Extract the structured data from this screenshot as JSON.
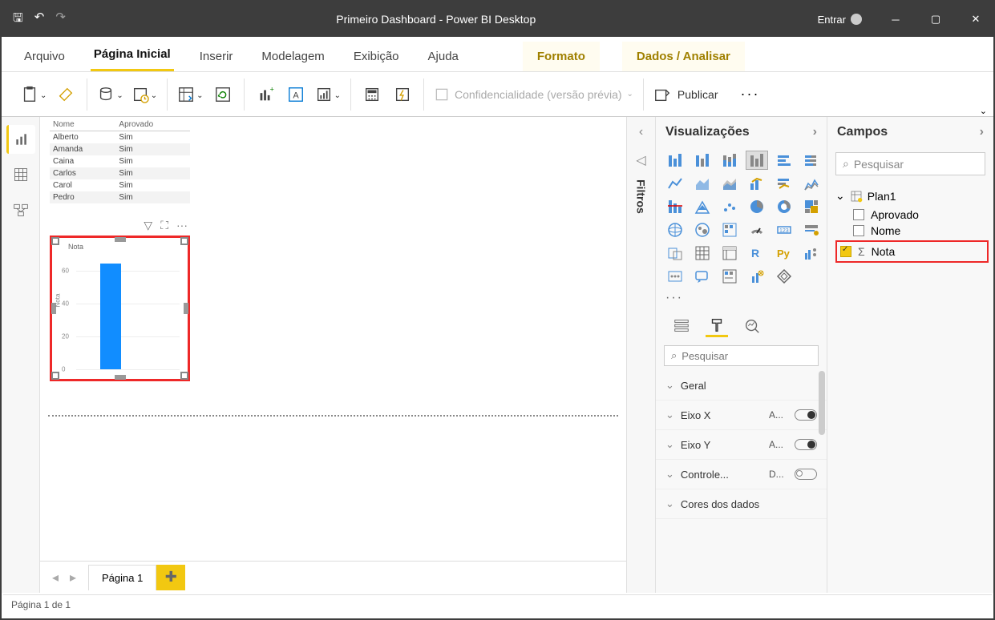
{
  "titlebar": {
    "title": "Primeiro Dashboard - Power BI Desktop",
    "signin": "Entrar"
  },
  "ribbon": {
    "tabs": [
      "Arquivo",
      "Página Inicial",
      "Inserir",
      "Modelagem",
      "Exibição",
      "Ajuda"
    ],
    "context_tabs": [
      "Formato",
      "Dados / Analisar"
    ],
    "active": "Página Inicial",
    "confidentiality": "Confidencialidade (versão prévia)",
    "publish": "Publicar"
  },
  "table_visual": {
    "columns": [
      "Nome",
      "Aprovado"
    ],
    "rows": [
      [
        "Alberto",
        "Sim"
      ],
      [
        "Amanda",
        "Sim"
      ],
      [
        "Caina",
        "Sim"
      ],
      [
        "Carlos",
        "Sim"
      ],
      [
        "Carol",
        "Sim"
      ],
      [
        "Pedro",
        "Sim"
      ]
    ]
  },
  "chart_data": {
    "type": "bar",
    "title": "Nota",
    "ylabel": "Nota",
    "categories": [
      ""
    ],
    "values": [
      64
    ],
    "ylim": [
      0,
      70
    ],
    "yticks": [
      0,
      20,
      40,
      60
    ]
  },
  "page_tabs": {
    "active": "Página 1"
  },
  "filters": {
    "label": "Filtros"
  },
  "visualizations": {
    "title": "Visualizações",
    "search_placeholder": "Pesquisar",
    "format_groups": [
      {
        "name": "Geral",
        "value": "",
        "toggle": null
      },
      {
        "name": "Eixo X",
        "value": "A...",
        "toggle": "on"
      },
      {
        "name": "Eixo Y",
        "value": "A...",
        "toggle": "on"
      },
      {
        "name": "Controle...",
        "value": "D...",
        "toggle": "off"
      },
      {
        "name": "Cores dos dados",
        "value": "",
        "toggle": null
      }
    ]
  },
  "fields": {
    "title": "Campos",
    "search_placeholder": "Pesquisar",
    "table": "Plan1",
    "items": [
      {
        "name": "Aprovado",
        "checked": false,
        "sigma": false,
        "highlighted": false
      },
      {
        "name": "Nome",
        "checked": false,
        "sigma": false,
        "highlighted": false
      },
      {
        "name": "Nota",
        "checked": true,
        "sigma": true,
        "highlighted": true
      }
    ]
  },
  "status": "Página 1 de 1"
}
